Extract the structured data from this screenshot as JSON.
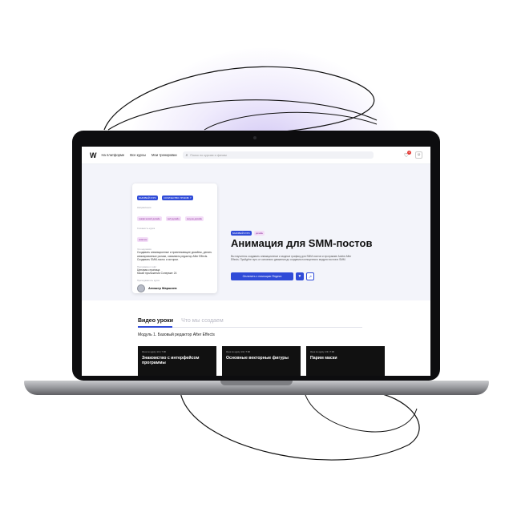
{
  "nav": {
    "links": [
      "На платформе",
      "Все курсы",
      "Мои тренировки"
    ],
    "search_placeholder": "Поиск по курсам и фичам",
    "notification_count": "2"
  },
  "course_card": {
    "tags_top": [
      "БАЗОВЫЙ КУРС",
      "КОЛИЧЕСТВО УРОКОВ: 7"
    ],
    "direction_label": "Направления",
    "direction_tags": [
      "графический дизайн",
      "веб-дизайн",
      "моушн-дизайн"
    ],
    "level_label": "Сложность курса",
    "level_tag": "новичок",
    "what_label": "Что научимся",
    "what_text": "Создавать анимационные и привлекающие дизайны, делать анимированные ролики, осваивать редактор After Effects. Создавать SMM-посты и истории.",
    "tools_label": "Программа и софт",
    "tools_text": "Ценовая страница\nКачай приложения Сопермат 24",
    "author_label": "Преподаватель курса",
    "author_name": "Алишер Маршиев"
  },
  "hero": {
    "tags": [
      "БАЗОВЫЙ КУРС",
      "дизайн"
    ],
    "title": "Анимация для SMM-постов",
    "description": "Вы научитесь создавать анимационные и модные графику для SMM-постов и программе Adobe After Effects. Пройдёте путь от основного движения до создания полноценного модуля постов в SMM.",
    "primary_button": "Оплатить с помощью Яндекс",
    "heart_button": "♥",
    "share_button": "↗"
  },
  "content": {
    "tabs": [
      "Видео уроки",
      "Что мы создаем"
    ],
    "module_title": "Модуль 1. Базовый редактор After Effects",
    "lessons": [
      {
        "meta": "Урок по курсу 1/1 | 7:00",
        "title": "Знакомство с интерфейсом программы"
      },
      {
        "meta": "Урок по курсу 1/2 | 7:00",
        "title": "Основные векторные фигуры"
      },
      {
        "meta": "Урок по курсу 1/3 | 7:00",
        "title": "Парим маски"
      }
    ]
  },
  "colors": {
    "accent": "#2f4bd8",
    "glow": "#b9a8f0",
    "laptop_body": "#0d0d0f"
  }
}
